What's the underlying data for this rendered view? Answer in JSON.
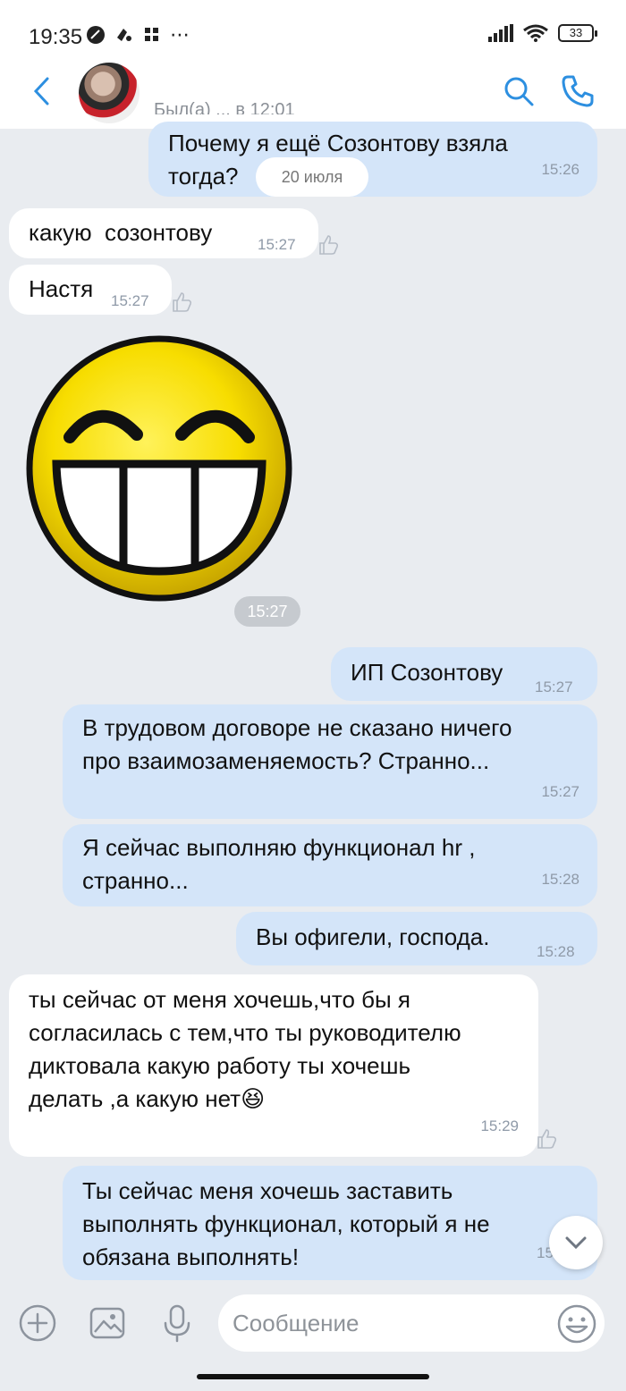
{
  "status_bar": {
    "time": "19:35",
    "extra_icons": "⋯",
    "battery": "33"
  },
  "header": {
    "subtitle": "Был(а) ... в 12:01"
  },
  "chat": {
    "date_chip": "20 июля",
    "messages": [
      {
        "dir": "out",
        "text": "Почему я ещё Созонтову взяла тогда?",
        "time": "15:26"
      },
      {
        "dir": "in",
        "text": "какую  созонтову",
        "time": "15:27"
      },
      {
        "dir": "in",
        "text": "Настя",
        "time": "15:27"
      },
      {
        "dir": "out",
        "text": "ИП Созонтову",
        "time": "15:27"
      },
      {
        "dir": "out",
        "text": "В трудовом договоре не сказано ничего про взаимозаменяемость? Странно...",
        "time": "15:27"
      },
      {
        "dir": "out",
        "text": "Я сейчас выполняю функционал hr , странно...",
        "time": "15:28"
      },
      {
        "dir": "out",
        "text": "Вы офигели, господа.",
        "time": "15:28"
      },
      {
        "dir": "in",
        "text": "ты сейчас от меня хочешь,что бы я согласилась с тем,что ты руководителю диктовала какую работу ты хочешь делать ,а какую нет😆",
        "time": "15:29"
      },
      {
        "dir": "out",
        "text": "Ты сейчас меня хочешь заставить выполнять функционал, который я не обязана выполнять!",
        "time": "15:."
      }
    ],
    "sticker": {
      "icon": "grinning-smiley-sticker",
      "time": "15:27"
    }
  },
  "composer": {
    "placeholder": "Сообщение"
  },
  "colors": {
    "outgoing_bubble": "#d4e5f9",
    "incoming_bubble": "#ffffff",
    "background": "#e9ecf0",
    "accent": "#2d8fe0"
  }
}
